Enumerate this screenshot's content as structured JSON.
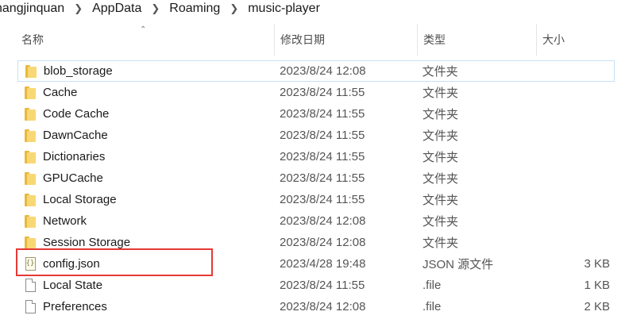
{
  "breadcrumb": [
    "nangjinquan",
    "AppData",
    "Roaming",
    "music-player"
  ],
  "columns": {
    "name": "名称",
    "date": "修改日期",
    "type": "类型",
    "size": "大小"
  },
  "files": [
    {
      "name": "blob_storage",
      "date": "2023/8/24 12:08",
      "type": "文件夹",
      "size": "",
      "icon": "folder-icon"
    },
    {
      "name": "Cache",
      "date": "2023/8/24 11:55",
      "type": "文件夹",
      "size": "",
      "icon": "folder-icon"
    },
    {
      "name": "Code Cache",
      "date": "2023/8/24 11:55",
      "type": "文件夹",
      "size": "",
      "icon": "folder-icon"
    },
    {
      "name": "DawnCache",
      "date": "2023/8/24 11:55",
      "type": "文件夹",
      "size": "",
      "icon": "folder-icon"
    },
    {
      "name": "Dictionaries",
      "date": "2023/8/24 11:55",
      "type": "文件夹",
      "size": "",
      "icon": "folder-icon"
    },
    {
      "name": "GPUCache",
      "date": "2023/8/24 11:55",
      "type": "文件夹",
      "size": "",
      "icon": "folder-icon"
    },
    {
      "name": "Local Storage",
      "date": "2023/8/24 11:55",
      "type": "文件夹",
      "size": "",
      "icon": "folder-icon"
    },
    {
      "name": "Network",
      "date": "2023/8/24 12:08",
      "type": "文件夹",
      "size": "",
      "icon": "folder-icon"
    },
    {
      "name": "Session Storage",
      "date": "2023/8/24 12:08",
      "type": "文件夹",
      "size": "",
      "icon": "folder-icon"
    },
    {
      "name": "config.json",
      "date": "2023/4/28 19:48",
      "type": "JSON 源文件",
      "size": "3 KB",
      "icon": "json-file-icon"
    },
    {
      "name": "Local State",
      "date": "2023/8/24 11:55",
      "type": ".file",
      "size": "1 KB",
      "icon": "file-icon"
    },
    {
      "name": "Preferences",
      "date": "2023/8/24 12:08",
      "type": ".file",
      "size": "2 KB",
      "icon": "file-icon"
    }
  ],
  "highlight_color": "#e53935",
  "folder_color": "#f8d775"
}
